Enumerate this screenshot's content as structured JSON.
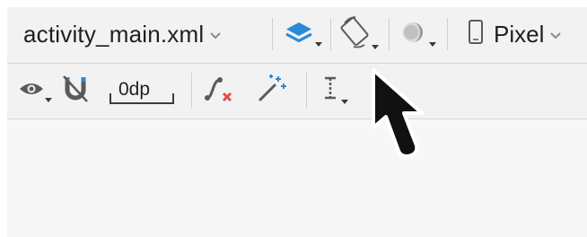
{
  "toolbar_top": {
    "file_name": "activity_main.xml",
    "design_surface_icon": "layers-icon",
    "orientation_icon": "rotate-orientation-icon",
    "theme_icon": "night-mode-icon",
    "device_icon": "phone-device-icon",
    "device_name": "Pixel"
  },
  "toolbar_bottom": {
    "view_options_icon": "eye-icon",
    "autoconnect_icon": "magnet-off-icon",
    "default_margin": "0dp",
    "clear_constraints_icon": "clear-constraints-icon",
    "infer_constraints_icon": "magic-wand-icon",
    "guidelines_icon": "align-guidelines-icon"
  },
  "colors": {
    "accent_blue": "#2b8ad8",
    "accent_red": "#e0484b",
    "icon_gray": "#5a5a5a"
  }
}
